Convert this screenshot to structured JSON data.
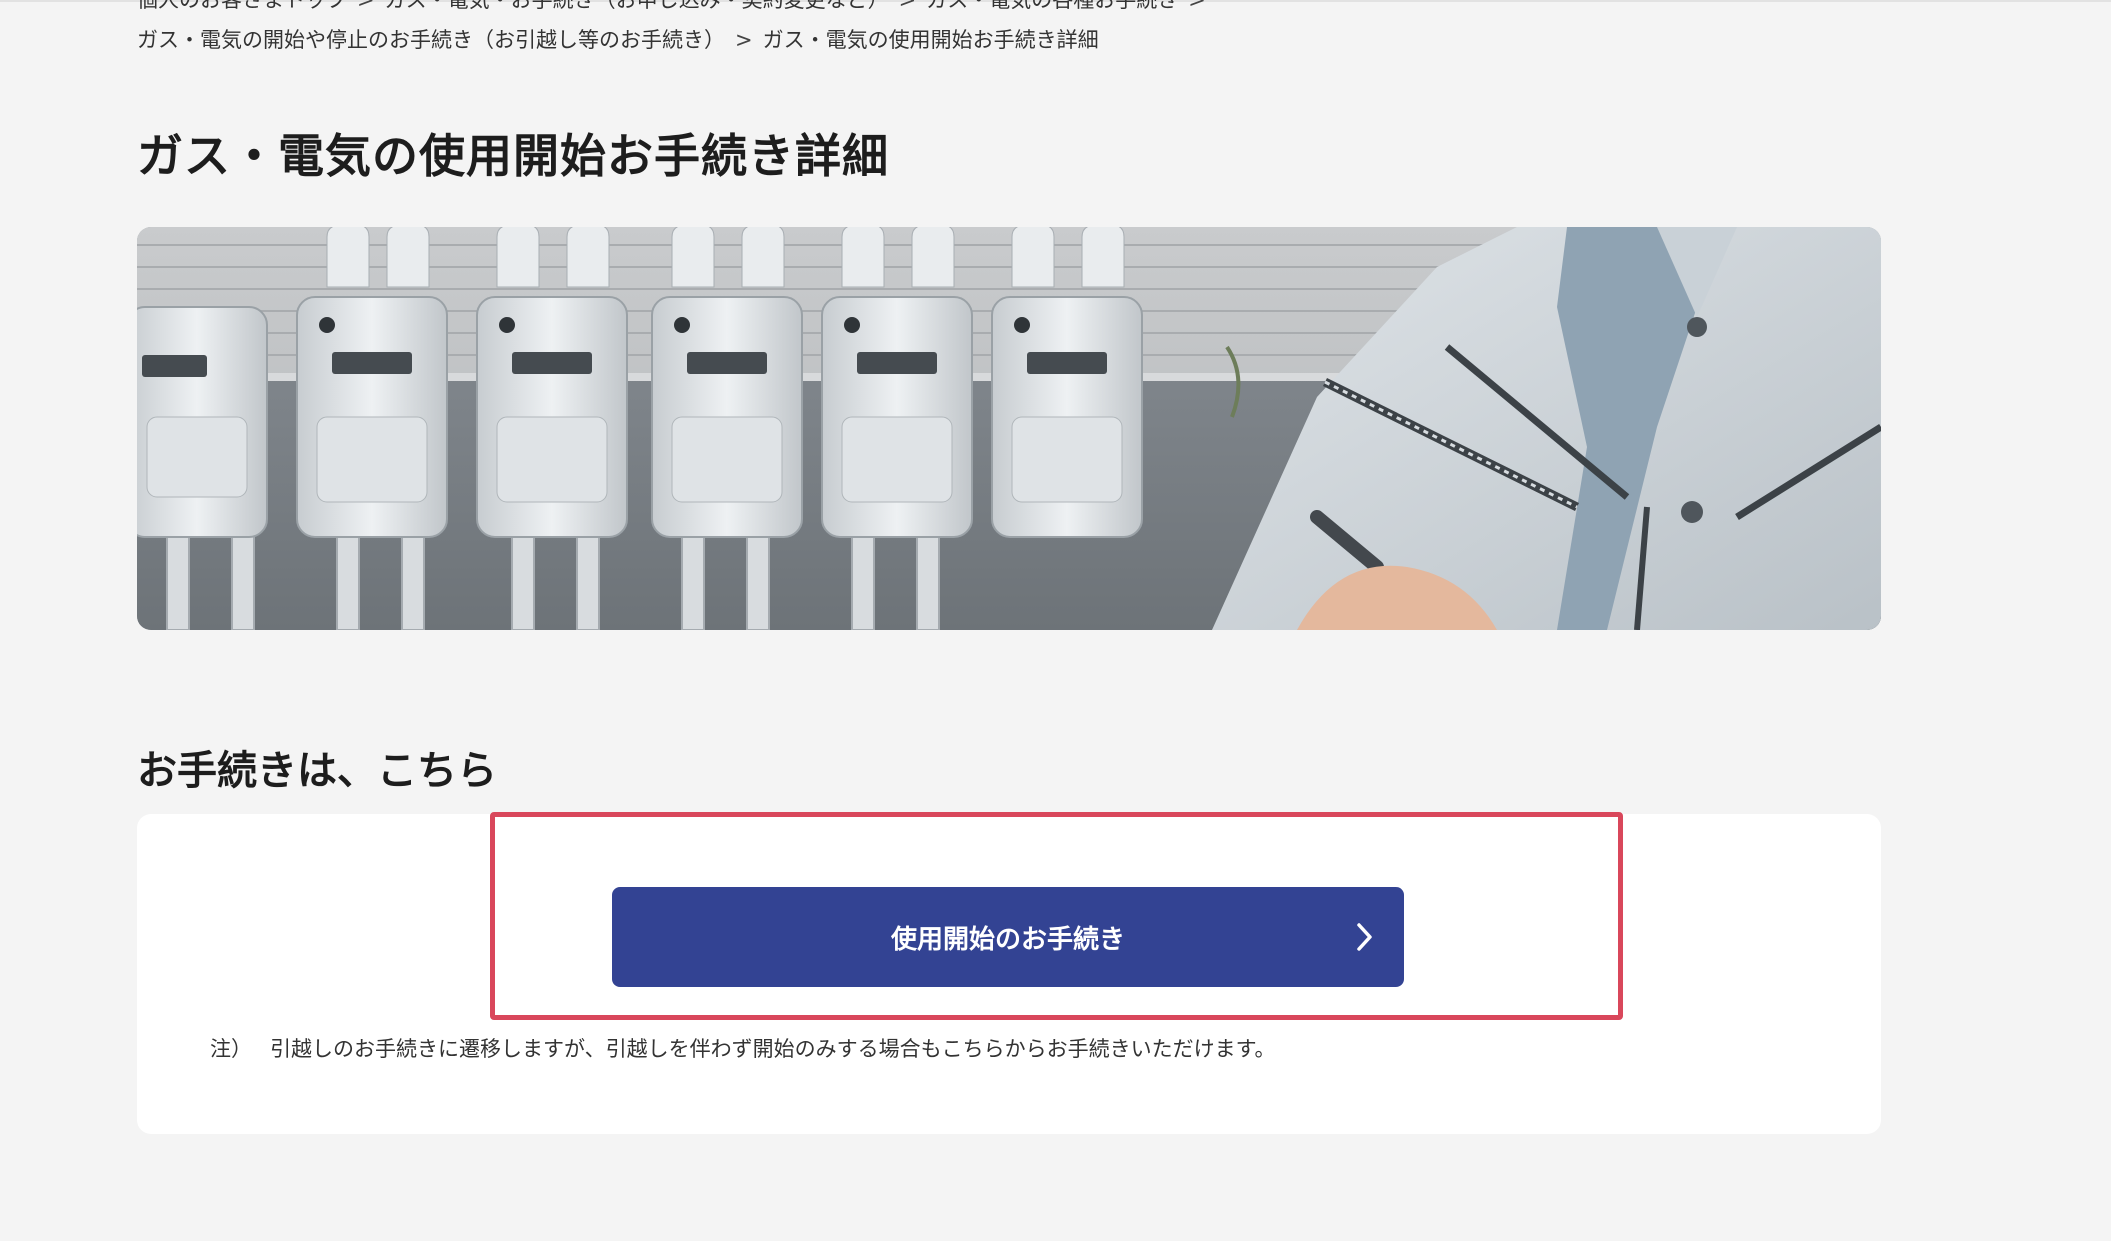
{
  "breadcrumb": {
    "line1": [
      {
        "label": "個人のお客さまトップ"
      },
      {
        "label": "ガス・電気・お手続き（お申し込み・契約変更など）"
      },
      {
        "label": "ガス・電気の各種お手続き"
      }
    ],
    "line2": [
      {
        "label": "ガス・電気の開始や停止のお手続き（お引越し等のお手続き）"
      },
      {
        "label": "ガス・電気の使用開始お手続き詳細"
      }
    ],
    "separator": ">"
  },
  "page": {
    "title": "ガス・電気の使用開始お手続き詳細"
  },
  "procedure": {
    "heading": "お手続きは、こちら",
    "button_label": "使用開始のお手続き",
    "note_prefix": "注）",
    "note_text": "引越しのお手続きに遷移しますが、引越しを伴わず開始のみする場合もこちらからお手続きいただけます。"
  },
  "colors": {
    "button_bg": "#334393",
    "highlight_border": "#d9475b",
    "page_bg": "#f4f4f4"
  },
  "icons": {
    "button_arrow": "chevron-right-icon"
  }
}
